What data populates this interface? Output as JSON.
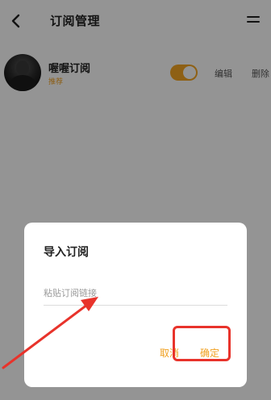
{
  "header": {
    "title": "订阅管理",
    "back_icon": "chevron-left-icon",
    "menu_icon": "menu-icon"
  },
  "subscription": {
    "name": "喔喔订阅",
    "tag": "推荐",
    "enabled": true,
    "edit_label": "编辑",
    "delete_label": "删除"
  },
  "dialog": {
    "title": "导入订阅",
    "input_placeholder": "粘贴订阅链接",
    "input_value": "",
    "cancel_label": "取消",
    "confirm_label": "确定"
  },
  "colors": {
    "accent": "#f5a623",
    "annotation": "#e8332b"
  }
}
